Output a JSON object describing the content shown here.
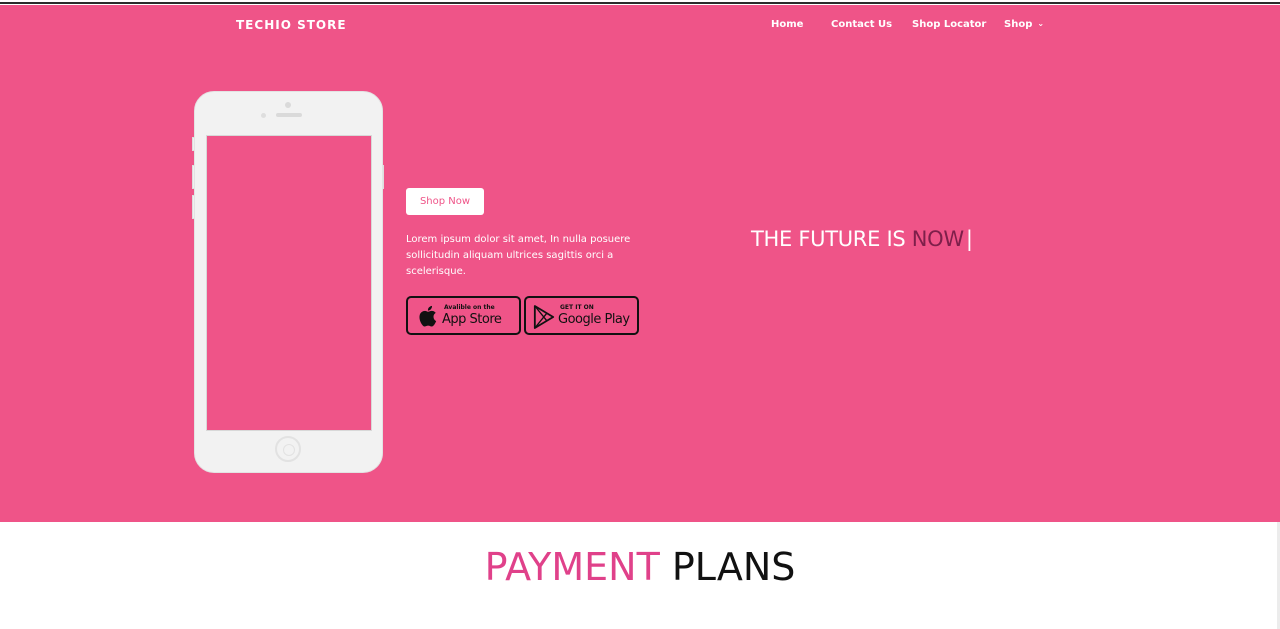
{
  "header": {
    "brand": "TECHIO STORE",
    "nav": [
      {
        "label": "Home"
      },
      {
        "label": "Contact Us"
      },
      {
        "label": "Shop Locator"
      },
      {
        "label": "Shop",
        "chevron": "chevron-down-icon"
      }
    ]
  },
  "hero": {
    "shop_now_label": "Shop Now",
    "description": "Lorem ipsum dolor sit amet, In nulla posuere sollicitudin aliquam ultrices sagittis orci a scelerisque.",
    "badges": {
      "app_store": {
        "small": "Avalible on the",
        "big": "App Store",
        "icon": "apple-icon"
      },
      "google_play": {
        "small": "GET IT ON",
        "big": "Google Play",
        "icon": "google-play-icon"
      }
    },
    "tagline": {
      "prefix": "THE FUTURE IS ",
      "highlight": "NOW",
      "cursor": "|"
    }
  },
  "section": {
    "title_part1": "PAYMENT",
    "title_part2": "PLANS"
  },
  "colors": {
    "hero_bg": "#ef5488",
    "accent_dark": "#7e1f4a",
    "title_pink": "#e0418a",
    "text_dark": "#111111"
  }
}
